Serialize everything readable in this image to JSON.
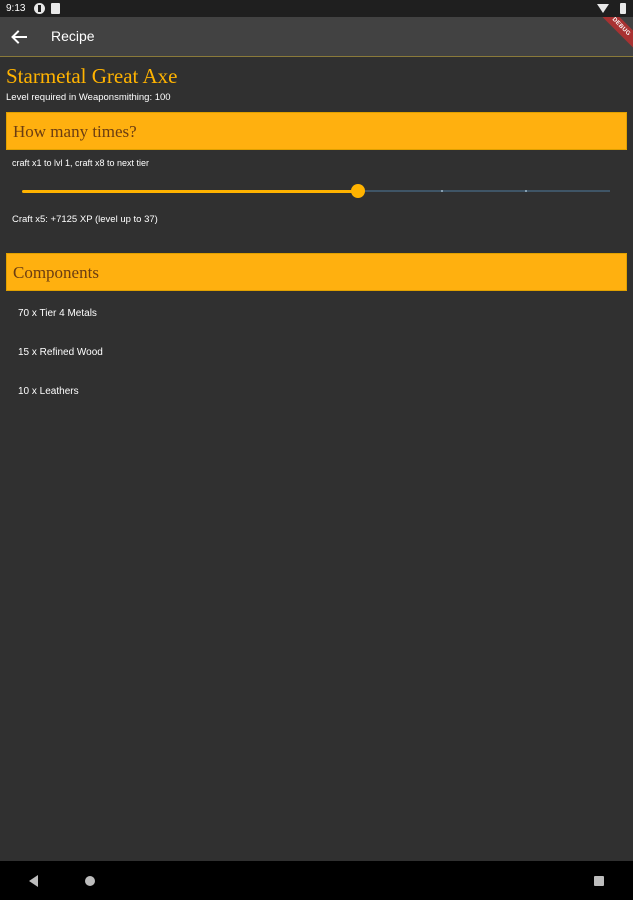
{
  "status_bar": {
    "time": "9:13",
    "icons": [
      "app-notification-icon",
      "file-icon",
      "wifi-icon",
      "battery-icon"
    ]
  },
  "app_bar": {
    "title": "Recipe",
    "back_icon": "arrow-left-icon",
    "debug_banner": "DEBUG"
  },
  "item": {
    "name": "Starmetal Great Axe",
    "level_required": "Level required in Weaponsmithing: 100"
  },
  "craft_section": {
    "header": "How many times?",
    "hint": "craft x1 to lvl 1, craft x8 to next tier",
    "slider": {
      "min": 1,
      "max": 8,
      "value": 5
    },
    "xp_text": "Craft x5: +7125 XP (level up to 37)"
  },
  "components_section": {
    "header": "Components",
    "items": [
      "70 x Tier 4 Metals",
      "15 x Refined Wood",
      "10 x Leathers"
    ]
  },
  "nav_bar": {
    "icons": [
      "nav-back-icon",
      "nav-home-icon",
      "nav-recents-icon"
    ]
  },
  "colors": {
    "accent": "#ffb300",
    "header_bg": "#ffb00f",
    "header_text": "#6b3d12",
    "background": "#303030",
    "app_bar": "#424242"
  }
}
